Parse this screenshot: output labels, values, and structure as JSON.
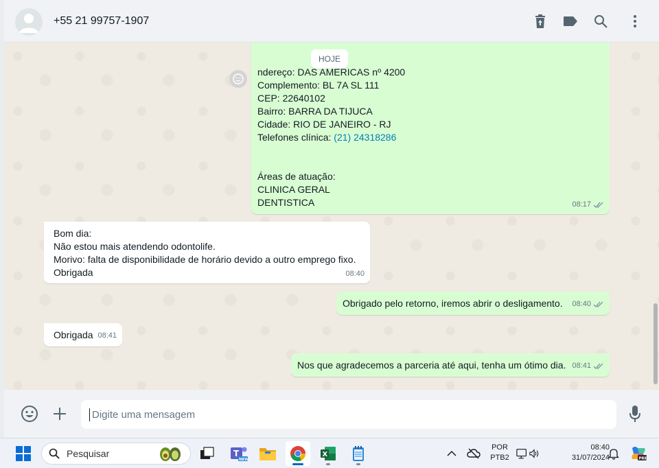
{
  "header": {
    "contact": "+55 21 99757-1907",
    "icons": [
      "delete-icon",
      "label-icon",
      "search-icon",
      "menu-icon"
    ]
  },
  "chat": {
    "day_label": "HOJE",
    "address_message": {
      "lines": [
        "ndereço: DAS AMÉRICAS nº 4200",
        "Complemento: BL 7A SL 111",
        "CEP: 22640102",
        "Bairro: BARRA DA TIJUCA",
        "Cidade: RIO DE JANEIRO - RJ"
      ],
      "phone_label": "Telefones clínica: ",
      "phone_link": "(21) 24318286",
      "areas_lines": [
        "Áreas de atuação:",
        "CLINICA GERAL",
        "DENTISTICA"
      ],
      "time": "08:17"
    },
    "incoming_1": {
      "lines": [
        "Bom dia:",
        "Não estou mais atendendo odontolife.",
        "Morivo: falta de disponibilidade de horário devido a outro emprego fixo.",
        "Obrigada"
      ],
      "time": "08:40"
    },
    "outgoing_1": {
      "text": "Obrigado pelo retorno, iremos abrir o desligamento.",
      "time": "08:40"
    },
    "incoming_2": {
      "text": "Obrigada",
      "time": "08:41"
    },
    "outgoing_2": {
      "text": "Nos que agradecemos a parceria até aqui, tenha um ótimo dia.",
      "time": "08:41"
    }
  },
  "composer": {
    "placeholder": "Digite uma mensagem"
  },
  "taskbar": {
    "search_label": "Pesquisar",
    "lang_1": "POR",
    "lang_2": "PTB2",
    "clock_time": "08:40",
    "clock_date": "31/07/2024"
  },
  "colors": {
    "outgoing_bubble": "#d9fdd3",
    "incoming_bubble": "#ffffff",
    "chat_bg": "#efeae2",
    "link": "#027eb5",
    "read_ticks": "#8696a0"
  }
}
